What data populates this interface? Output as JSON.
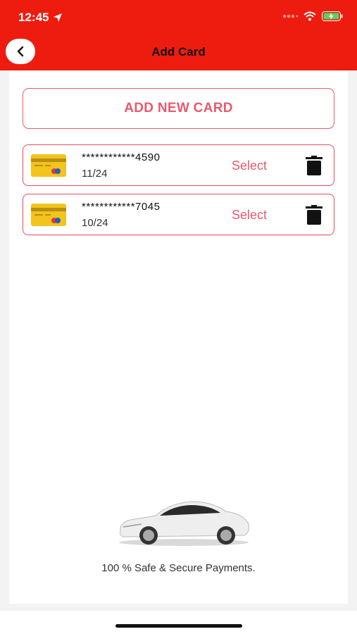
{
  "status_bar": {
    "time": "12:45"
  },
  "header": {
    "title": "Add Card"
  },
  "add_button": {
    "label": "ADD NEW CARD"
  },
  "cards": [
    {
      "number": "************4590",
      "expiry": "11/24",
      "select_label": "Select"
    },
    {
      "number": "************7045",
      "expiry": "10/24",
      "select_label": "Select"
    }
  ],
  "footer": {
    "text": "100 % Safe & Secure Payments."
  },
  "icons": {
    "back": "chevron-left-icon",
    "delete": "trash-icon",
    "card": "credit-card-icon",
    "car": "car-image",
    "location": "location-arrow-icon",
    "wifi": "wifi-icon",
    "battery": "battery-charging-icon",
    "signal": "signal-icon"
  },
  "colors": {
    "header": "#ee1c0e",
    "accent": "#e85a6e",
    "card_yellow": "#f2c41d"
  }
}
